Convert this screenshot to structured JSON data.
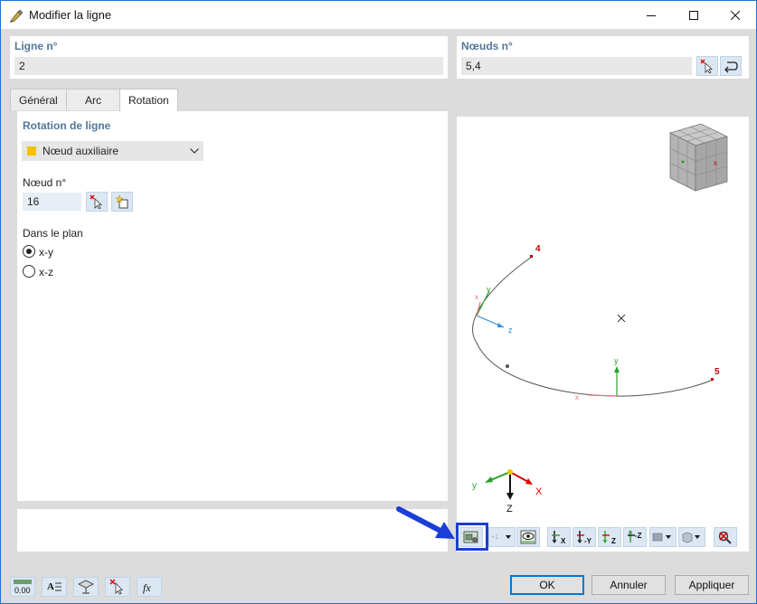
{
  "window": {
    "title": "Modifier la ligne",
    "accent": "#1976d2"
  },
  "line_no": {
    "label": "Ligne n°",
    "value": "2"
  },
  "nodes_no": {
    "label": "Nœuds n°",
    "value": "5,4"
  },
  "tabs": [
    {
      "label": "Général",
      "active": false
    },
    {
      "label": "Arc",
      "active": false
    },
    {
      "label": "Rotation",
      "active": true
    }
  ],
  "rotation": {
    "section_title": "Rotation de ligne",
    "type_selected": "Nœud auxiliaire",
    "type_color": "#f5c200",
    "node_label": "Nœud n°",
    "node_value": "16",
    "plane_label": "Dans le plan",
    "plane_options": [
      {
        "label": "x-y",
        "checked": true
      },
      {
        "label": "x-z",
        "checked": false
      }
    ]
  },
  "preview": {
    "node_labels": {
      "n4": "4",
      "n5": "5"
    },
    "local_axes": {
      "y": "y",
      "z": "z",
      "x": "x"
    },
    "global_axes": {
      "x": "X",
      "y": "y",
      "z": "Z"
    },
    "node_color": "#c00000"
  },
  "toolbar": {
    "icons": [
      "view-settings-icon",
      "numbering-dropdown-icon",
      "visibility-icon",
      "view-x-icon",
      "view-minus-y-icon",
      "view-z-icon",
      "view-minus-z-icon",
      "render-dropdown-icon",
      "iso-dropdown-icon",
      "reset-view-icon"
    ],
    "labels": {
      "x": "X",
      "my": "-Y",
      "z": "Z",
      "mz": "-Z"
    }
  },
  "buttons": {
    "ok": "OK",
    "cancel": "Annuler",
    "apply": "Appliquer",
    "units_value": "0.00"
  }
}
